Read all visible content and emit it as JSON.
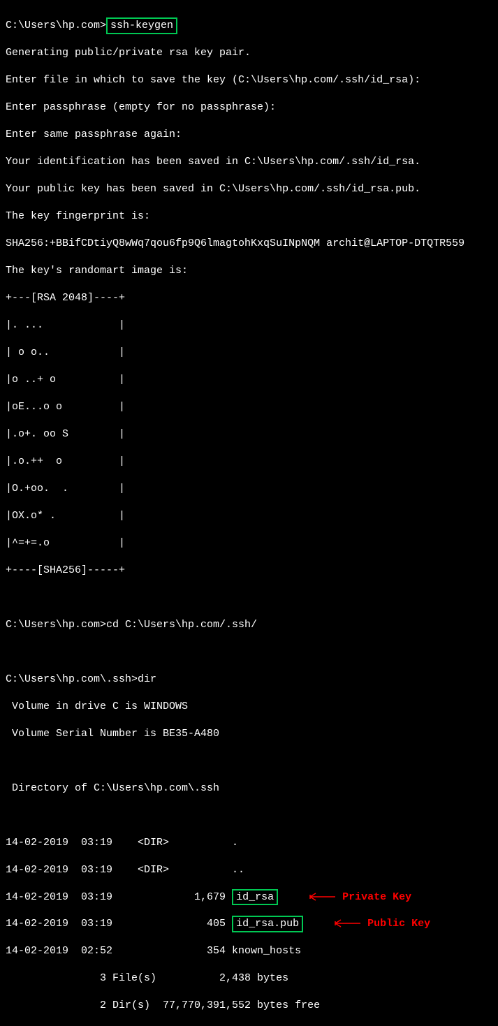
{
  "prompt1": "C:\\Users\\hp.com>",
  "command1": "ssh-keygen",
  "output": {
    "l1": "Generating public/private rsa key pair.",
    "l2": "Enter file in which to save the key (C:\\Users\\hp.com/.ssh/id_rsa):",
    "l3": "Enter passphrase (empty for no passphrase):",
    "l4": "Enter same passphrase again:",
    "l5": "Your identification has been saved in C:\\Users\\hp.com/.ssh/id_rsa.",
    "l6": "Your public key has been saved in C:\\Users\\hp.com/.ssh/id_rsa.pub.",
    "l7": "The key fingerprint is:",
    "l8": "SHA256:+BBifCDtiyQ8wWq7qou6fp9Q6lmagtohKxqSuINpNQM archit@LAPTOP-DTQTR559",
    "l9": "The key's randomart image is:",
    "art1": "+---[RSA 2048]----+",
    "art2": "|. ...            |",
    "art3": "| o o..           |",
    "art4": "|o ..+ o          |",
    "art5": "|oE...o o         |",
    "art6": "|.o+. oo S        |",
    "art7": "|.o.++  o         |",
    "art8": "|O.+oo.  .        |",
    "art9": "|OX.o* .          |",
    "art10": "|^=+=.o           |",
    "art11": "+----[SHA256]-----+"
  },
  "blank": "",
  "prompt2": "C:\\Users\\hp.com>cd C:\\Users\\hp.com/.ssh/",
  "prompt3": "C:\\Users\\hp.com\\.ssh>dir",
  "dir": {
    "l1": " Volume in drive C is WINDOWS",
    "l2": " Volume Serial Number is BE35-A480",
    "l3": " Directory of C:\\Users\\hp.com\\.ssh",
    "r1": "14-02-2019  03:19    <DIR>          .",
    "r2": "14-02-2019  03:19    <DIR>          ..",
    "r3a": "14-02-2019  03:19             1,679 ",
    "r3b": "id_rsa",
    "r4a": "14-02-2019  03:19               405 ",
    "r4b": "id_rsa.pub",
    "r5": "14-02-2019  02:52               354 known_hosts",
    "s1": "               3 File(s)          2,438 bytes",
    "s2": "               2 Dir(s)  77,770,391,552 bytes free"
  },
  "labels": {
    "private": "Private Key",
    "public": "Public Key"
  }
}
